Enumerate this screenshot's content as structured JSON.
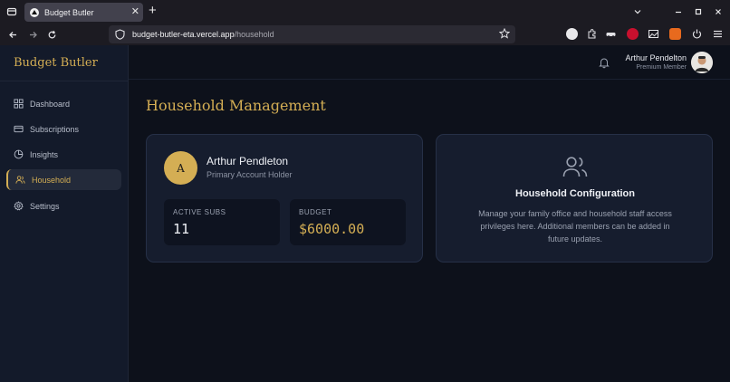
{
  "browser": {
    "tab_title": "Budget Butler",
    "url_host": "budget-butler-eta.vercel.app",
    "url_path": "/household"
  },
  "sidebar": {
    "brand": "Budget Butler",
    "items": [
      {
        "label": "Dashboard",
        "icon": "grid-icon"
      },
      {
        "label": "Subscriptions",
        "icon": "card-icon"
      },
      {
        "label": "Insights",
        "icon": "pie-icon"
      },
      {
        "label": "Household",
        "icon": "users-icon",
        "active": true
      },
      {
        "label": "Settings",
        "icon": "gear-icon"
      }
    ]
  },
  "header": {
    "user_name": "Arthur Pendelton",
    "user_role": "Premium Member"
  },
  "main": {
    "title": "Household Management",
    "holder": {
      "initial": "A",
      "name": "Arthur Pendleton",
      "role": "Primary Account Holder"
    },
    "stats": [
      {
        "label": "ACTIVE SUBS",
        "value": "11"
      },
      {
        "label": "BUDGET",
        "value": "$6000.00"
      }
    ],
    "config": {
      "title": "Household Configuration",
      "description": "Manage your family office and household staff access privileges here. Additional members can be added in future updates."
    }
  },
  "colors": {
    "accent": "#d4ae54",
    "background": "#0d111b",
    "sidebar": "#131a2a",
    "card": "#161d2e"
  }
}
